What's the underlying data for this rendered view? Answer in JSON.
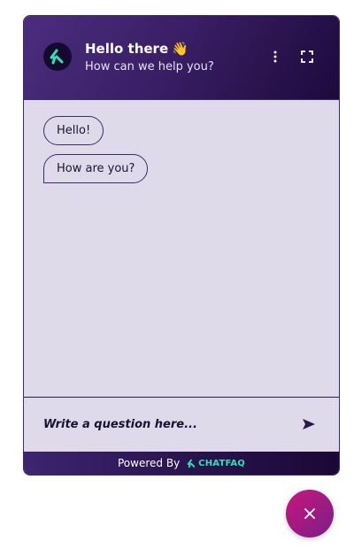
{
  "header": {
    "title": "Hello there",
    "title_emoji": "👋",
    "subtitle": "How can we help you?",
    "logo_icon": "chatfaq-logo-icon",
    "menu_icon": "more-vertical-icon",
    "fullscreen_icon": "fullscreen-icon"
  },
  "messages": [
    {
      "text": "Hello!"
    },
    {
      "text": "How are you?"
    }
  ],
  "composer": {
    "placeholder": "Write a question here...",
    "send_icon": "send-icon"
  },
  "footer": {
    "powered_by": "Powered By",
    "brand": "CHATFAQ"
  },
  "fab": {
    "icon": "close-icon"
  },
  "colors": {
    "primary": "#3a1f66",
    "chat_bg": "#dfdaea",
    "accent": "#2fe0b8",
    "fab": "#c8167a"
  }
}
